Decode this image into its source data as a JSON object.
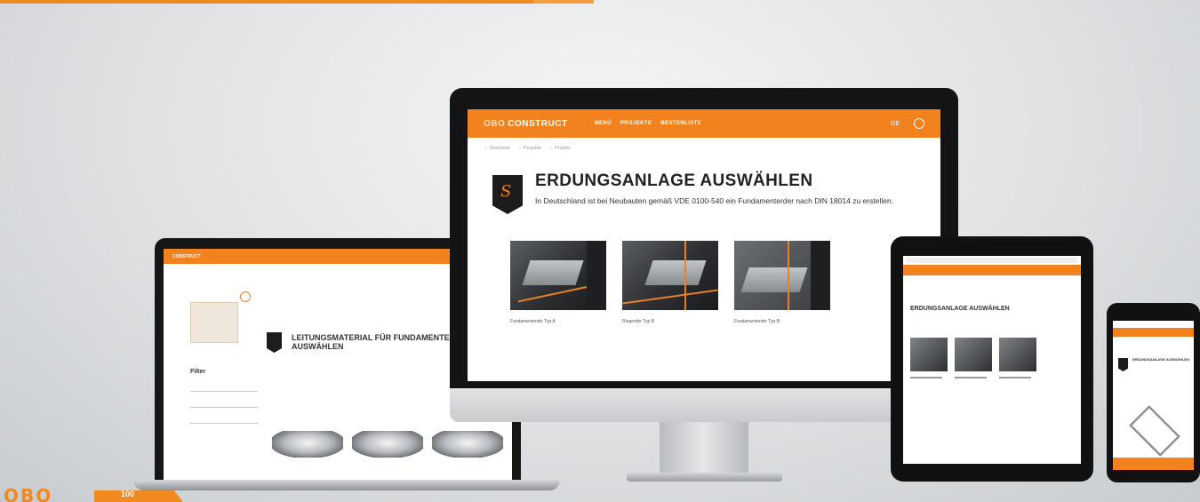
{
  "imac": {
    "nav": {
      "logo_prefix": "OBO",
      "logo_name": "CONSTRUCT",
      "links": [
        "MENÜ",
        "PROJEKTE",
        "BESTENLISTE"
      ],
      "language": "DE"
    },
    "breadcrumbs": [
      "Startseite",
      "Projekte",
      "Projekt"
    ],
    "hero": {
      "title": "ERDUNGSANLAGE AUSWÄHLEN",
      "description": "In Deutschland ist bei Neubauten gemäß VDE 0100-540 ein Fundamenterder nach DIN 18014 zu erstellen."
    },
    "tiles": [
      {
        "caption": "Fundamenterder Typ A"
      },
      {
        "caption": "Ringerder Typ B"
      },
      {
        "caption": "Fundamenterder Typ B"
      }
    ]
  },
  "laptop": {
    "title": "LEITUNGSMATERIAL FÜR FUNDAMENTERDER AUSWÄHLEN",
    "filter_label": "Filter"
  },
  "tablet": {
    "title": "ERDUNGSANLAGE AUSWÄHLEN"
  },
  "phone": {
    "title": "ERDUNGSANLAGE AUSWÄHLEN"
  },
  "branding": {
    "wordmark": "OBO",
    "tab_label": "100"
  },
  "colors": {
    "accent": "#f2821e",
    "dark": "#141414"
  }
}
